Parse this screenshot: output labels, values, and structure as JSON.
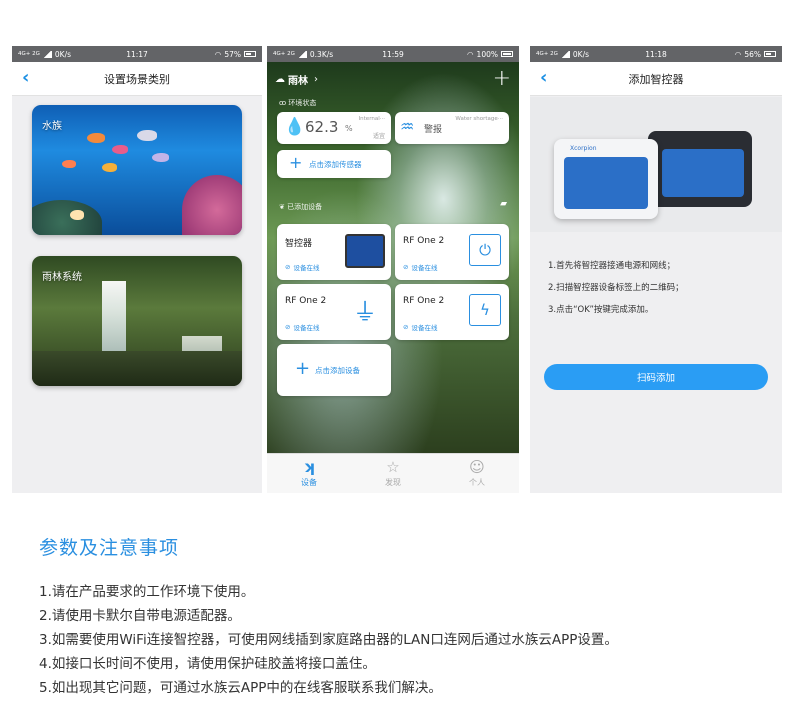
{
  "colors": {
    "accent": "#2a8fe0",
    "statusbar": "#636467",
    "button": "#2a9df4"
  },
  "phone1": {
    "status": {
      "net": "4G+ 2G",
      "speed": "0K/s",
      "time": "11:17",
      "battery": "57%"
    },
    "title": "设置场景类别",
    "back_icon": "back-chevron-icon",
    "cards": [
      {
        "label": "水族"
      },
      {
        "label": "雨林系统"
      }
    ]
  },
  "phone2": {
    "status": {
      "net": "4G+ 2G",
      "speed": "0.3K/s",
      "time": "11:59",
      "battery": "100%"
    },
    "scene": "雨林",
    "env_label": "环境状态",
    "humidity": {
      "value": "62.3",
      "unit": "%",
      "label": "Internal···",
      "status": "适宜"
    },
    "alarm": {
      "label": "警报",
      "desc": "Water shortage···"
    },
    "add_sensor": "点击添加传感器",
    "devices_label": "已添加设备",
    "devices": [
      {
        "name": "智控器",
        "status": "设备在线"
      },
      {
        "name": "RF One 2",
        "status": "设备在线"
      },
      {
        "name": "RF One 2",
        "status": "设备在线"
      },
      {
        "name": "RF One 2",
        "status": "设备在线"
      }
    ],
    "add_device": "点击添加设备",
    "tabs": [
      {
        "label": "设备"
      },
      {
        "label": "发现"
      },
      {
        "label": "个人"
      }
    ]
  },
  "phone3": {
    "status": {
      "net": "4G+ 2G",
      "speed": "0K/s",
      "time": "11:18",
      "battery": "56%"
    },
    "title": "添加智控器",
    "device_brand": "Xcorpion",
    "steps": [
      "1.首先将智控器接通电源和网线；",
      "2.扫描智控器设备标签上的二维码；",
      "3.点击“OK”按键完成添加。"
    ],
    "scan_button": "扫码添加"
  },
  "notes": {
    "title": "参数及注意事项",
    "items": [
      "1.请在产品要求的工作环境下使用。",
      "2.请使用卡默尔自带电源适配器。",
      "3.如需要使用WiFi连接智控器，可使用网线插到家庭路由器的LAN口连网后通过水族云APP设置。",
      "4.如接口长时间不使用，请使用保护硅胶盖将接口盖住。",
      "5.如出现其它问题，可通过水族云APP中的在线客服联系我们解决。"
    ]
  }
}
